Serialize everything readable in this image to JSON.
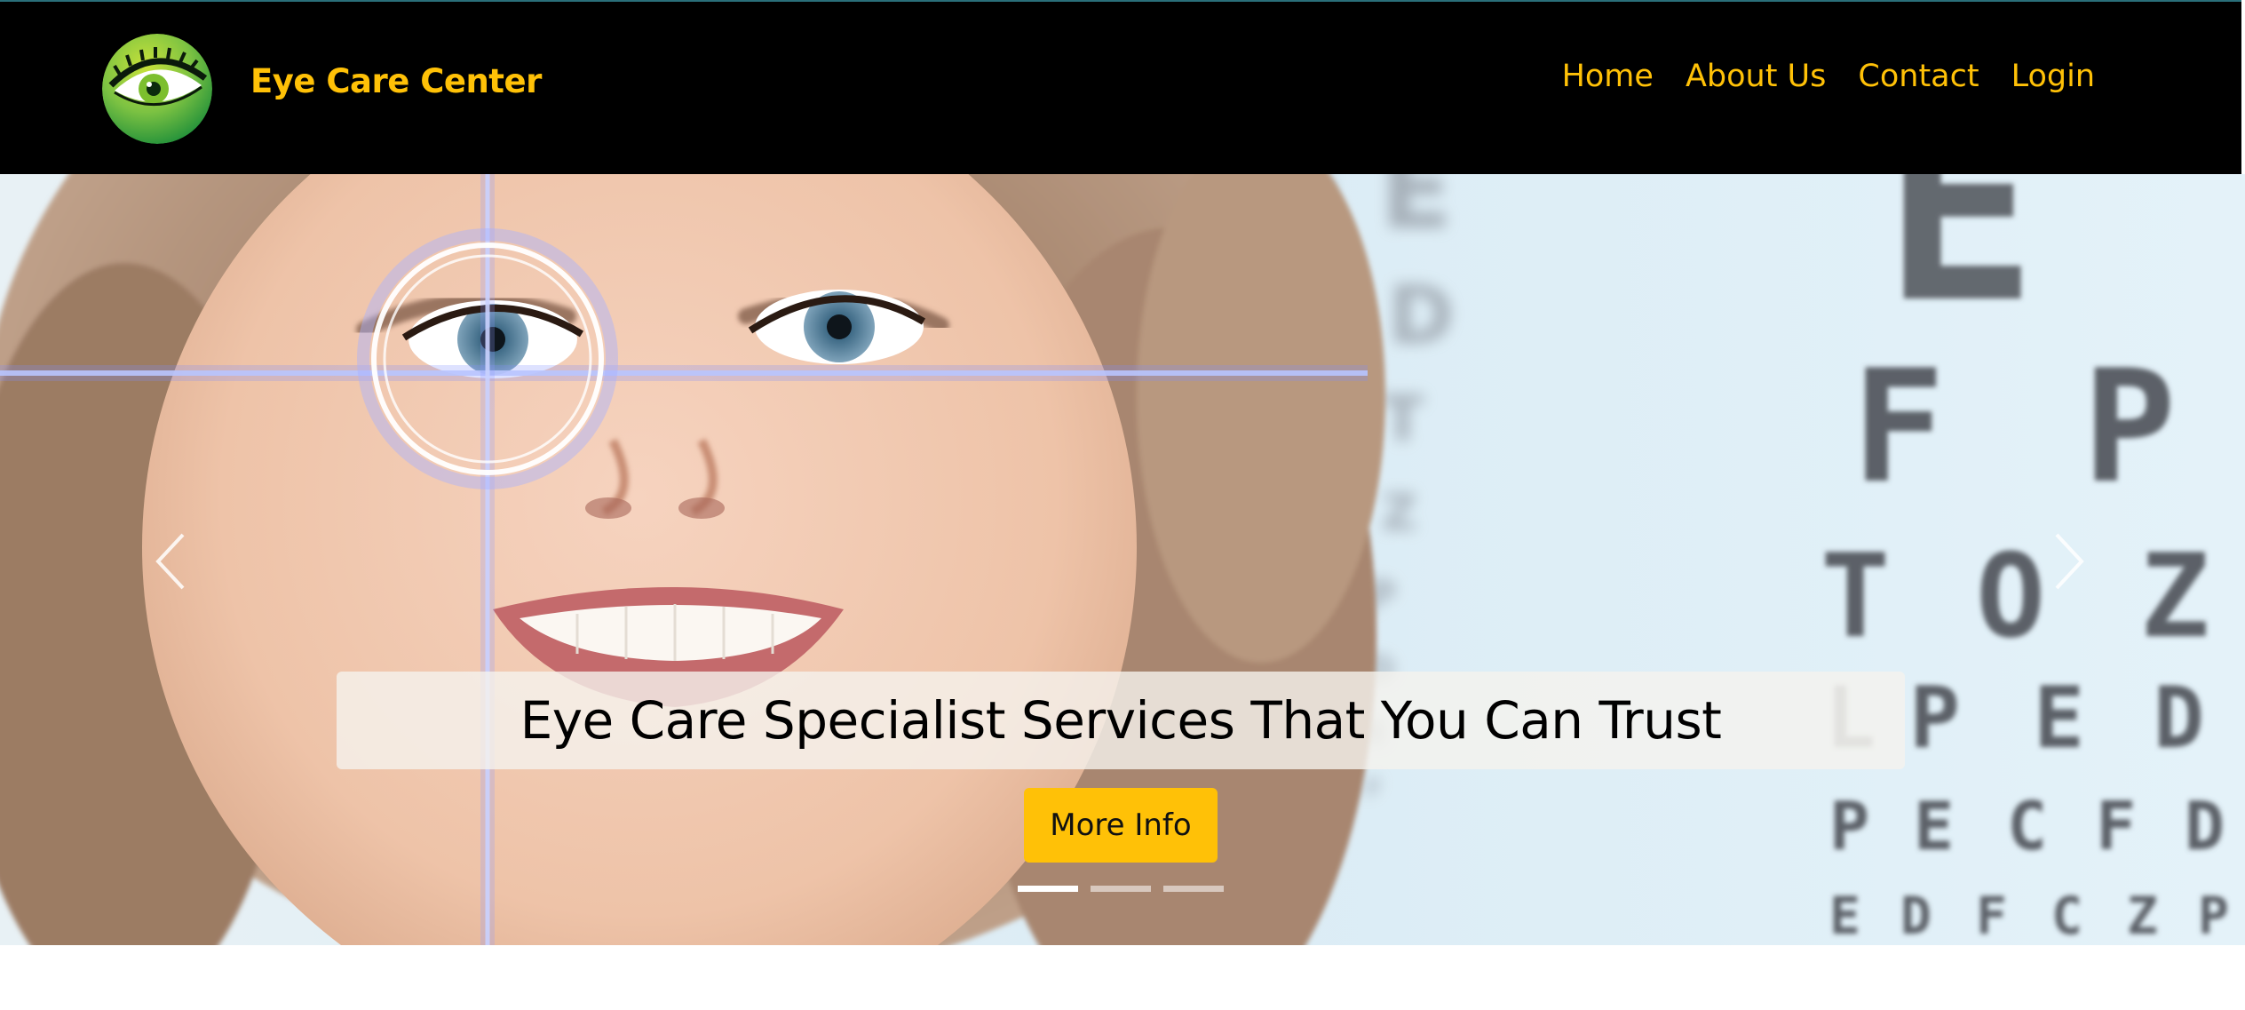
{
  "brand": {
    "name": "Eye Care Center",
    "logo_icon": "eye-logo-icon"
  },
  "nav": {
    "links": [
      {
        "label": "Home"
      },
      {
        "label": "About Us"
      },
      {
        "label": "Contact"
      },
      {
        "label": "Login"
      }
    ]
  },
  "hero": {
    "caption": "Eye Care Specialist Services That You Can Trust",
    "button_label": "More Info",
    "prev_icon": "chevron-left-icon",
    "next_icon": "chevron-right-icon",
    "slide_count": 3,
    "active_slide": 1,
    "eye_chart_letters": [
      "E",
      "F",
      "P",
      "T",
      "O",
      "Z",
      "L",
      "P",
      "E",
      "D",
      "P",
      "E",
      "C",
      "F",
      "D",
      "E",
      "D",
      "F",
      "C",
      "Z",
      "P"
    ]
  },
  "colors": {
    "accent": "#ffc107",
    "navbar_bg": "#000000",
    "logo_green": "#2e9e3e",
    "logo_lime": "#b6d832"
  }
}
